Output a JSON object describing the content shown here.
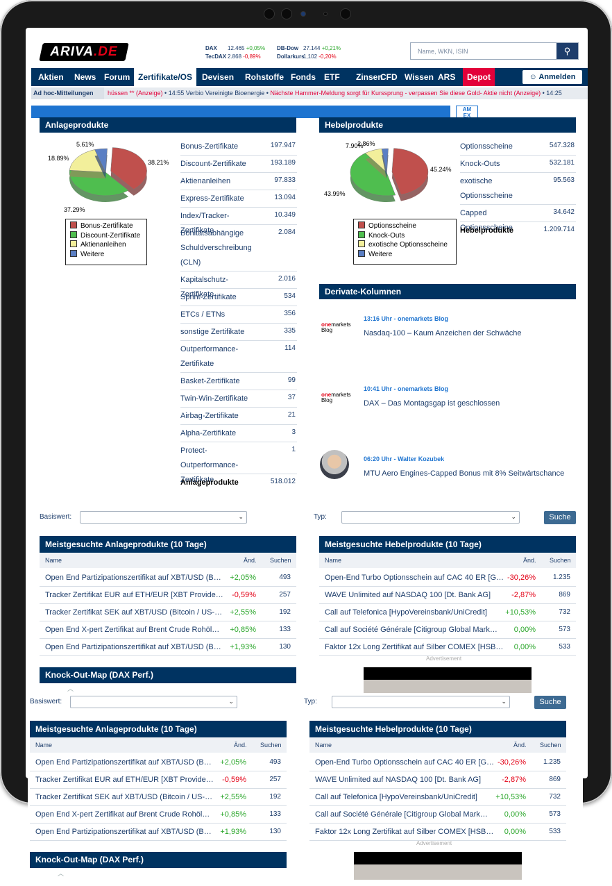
{
  "brand": {
    "logo_text": "ARIVA",
    "logo_tld": ".DE"
  },
  "tickers": [
    {
      "name": "DAX",
      "value": "12.465",
      "change": "+0,05%",
      "dir": "pos"
    },
    {
      "name": "TecDAX",
      "value": "2.868",
      "change": "-0,89%",
      "dir": "neg"
    },
    {
      "name": "DB-Dow",
      "value": "27.144",
      "change": "+0,21%",
      "dir": "pos"
    },
    {
      "name": "Dollarkurs",
      "value": "1,102",
      "change": "-0,20%",
      "dir": "neg"
    }
  ],
  "search": {
    "placeholder": "Name, WKN, ISIN",
    "icon": "search-icon"
  },
  "nav": {
    "items": [
      "Aktien",
      "News",
      "Forum",
      "Zertifikate/OS",
      "Devisen",
      "Rohstoffe",
      "Fonds",
      "ETF",
      "Zinsen",
      "CFD",
      "Wissen",
      "ARS",
      "Depot"
    ],
    "active": "Zertifikate/OS",
    "login_label": "Anmelden"
  },
  "adhoc": {
    "label": "Ad hoc-Mitteilungen",
    "ticker_1": "hüssen ** (Anzeige)",
    "ticker_2": " • 14:55 Verbio Vereinigte Bioenergie • ",
    "ticker_3": "Nächste Hammer-Meldung sorgt für Kurssprung - verpassen Sie diese Gold- Aktie nicht (Anzeige)",
    "ticker_4": " • 14:25"
  },
  "ad_logo": "AM\nEX",
  "anlage": {
    "title": "Anlageprodukte",
    "pie_labels": [
      "38.21%",
      "37.29%",
      "18.89%",
      "5.61%"
    ],
    "legend": [
      "Bonus-Zertifikate",
      "Discount-Zertifikate",
      "Aktienanleihen",
      "Weitere"
    ],
    "items": [
      {
        "label": "Bonus-Zertifikate",
        "value": "197.947"
      },
      {
        "label": "Discount-Zertifikate",
        "value": "193.189"
      },
      {
        "label": "Aktienanleihen",
        "value": "97.833"
      },
      {
        "label": "Express-Zertifikate",
        "value": "13.094"
      },
      {
        "label": "Index/Tracker-Zertifikate",
        "value": "10.349"
      },
      {
        "label": "Bonitätsabhängige Schuldverschreibung (CLN)",
        "value": "2.084"
      },
      {
        "label": "Kapitalschutz-Zertifikate",
        "value": "2.016"
      },
      {
        "label": "Sprint-Zertifikate",
        "value": "534"
      },
      {
        "label": "ETCs / ETNs",
        "value": "356"
      },
      {
        "label": "sonstige Zertifikate",
        "value": "335"
      },
      {
        "label": "Outperformance-Zertifikate",
        "value": "114"
      },
      {
        "label": "Basket-Zertifikate",
        "value": "99"
      },
      {
        "label": "Twin-Win-Zertifikate",
        "value": "37"
      },
      {
        "label": "Airbag-Zertifikate",
        "value": "21"
      },
      {
        "label": "Alpha-Zertifikate",
        "value": "3"
      },
      {
        "label": "Protect-Outperformance-Zertifikate",
        "value": "1"
      }
    ],
    "total_label": "Anlageprodukte",
    "total_value": "518.012"
  },
  "hebel": {
    "title": "Hebelprodukte",
    "pie_labels": [
      "45.24%",
      "43.99%",
      "7.90%",
      "2.86%"
    ],
    "legend": [
      "Optionsscheine",
      "Knock-Outs",
      "exotische Optionsscheine",
      "Weitere"
    ],
    "items": [
      {
        "label": "Optionsscheine",
        "value": "547.328"
      },
      {
        "label": "Knock-Outs",
        "value": "532.181"
      },
      {
        "label": "exotische Optionsscheine",
        "value": "95.563"
      },
      {
        "label": "Capped Optionsscheine",
        "value": "34.642"
      }
    ],
    "total_label": "Hebelprodukte",
    "total_value": "1.209.714"
  },
  "pie_colors": [
    "#c0504d",
    "#4fbe4f",
    "#f2ef9b",
    "#5b7fc4"
  ],
  "kolumnen": {
    "title": "Derivate-Kolumnen",
    "entries": [
      {
        "time": "13:16 Uhr - onemarkets Blog",
        "title": "Nasdaq-100 – Kaum Anzeichen der Schwäche",
        "source_logo": "onemarkets Blog"
      },
      {
        "time": "10:41 Uhr - onemarkets Blog",
        "title": "DAX – Das Montagsgap ist geschlossen",
        "source_logo": "onemarkets Blog"
      },
      {
        "time": "06:20 Uhr - Walter Kozubek",
        "title": "MTU Aero Engines-Capped Bonus mit 8% Seitwärtschance",
        "source_logo": ""
      }
    ]
  },
  "filters": {
    "basiswert_label": "Basiswert:",
    "typ_label": "Typ:",
    "search_button": "Suche"
  },
  "meist_anlage": {
    "title": "Meistgesuchte Anlageprodukte (10 Tage)",
    "headers": [
      "Name",
      "Änd.",
      "Suchen"
    ],
    "rows": [
      {
        "name": "Open End Partizipationszertifikat auf XBT/USD (B…",
        "chg": "+2,05%",
        "dir": "pos",
        "n": "493"
      },
      {
        "name": "Tracker Zertifikat EUR auf ETH/EUR [XBT Provide…",
        "chg": "-0,59%",
        "dir": "neg",
        "n": "257"
      },
      {
        "name": "Tracker Zertifikat SEK auf XBT/USD (Bitcoin / US-…",
        "chg": "+2,55%",
        "dir": "pos",
        "n": "192"
      },
      {
        "name": "Open End X-pert Zertifikat auf Brent Crude Rohöl…",
        "chg": "+0,85%",
        "dir": "pos",
        "n": "133"
      },
      {
        "name": "Open End Partizipationszertifikat auf XBT/USD (B…",
        "chg": "+1,93%",
        "dir": "pos",
        "n": "130"
      }
    ]
  },
  "meist_hebel": {
    "title": "Meistgesuchte Hebelprodukte (10 Tage)",
    "headers": [
      "Name",
      "Änd.",
      "Suchen"
    ],
    "rows": [
      {
        "name": "Open-End Turbo Optionsschein auf CAC 40 ER [G…",
        "chg": "-30,26%",
        "dir": "neg",
        "n": "1.235"
      },
      {
        "name": "WAVE Unlimited auf NASDAQ 100 [Dt. Bank AG]",
        "chg": "-2,87%",
        "dir": "neg",
        "n": "869"
      },
      {
        "name": "Call auf Telefonica [HypoVereinsbank/UniCredit]",
        "chg": "+10,53%",
        "dir": "pos",
        "n": "732"
      },
      {
        "name": "Call auf Société Générale [Citigroup Global Mark…",
        "chg": "0,00%",
        "dir": "pos",
        "n": "573"
      },
      {
        "name": "Faktor 12x Long Zertifikat auf Silber COMEX [HSB…",
        "chg": "0,00%",
        "dir": "pos",
        "n": "533"
      }
    ]
  },
  "knockout_title": "Knock-Out-Map (DAX Perf.)",
  "advertisement": "Advertisement"
}
